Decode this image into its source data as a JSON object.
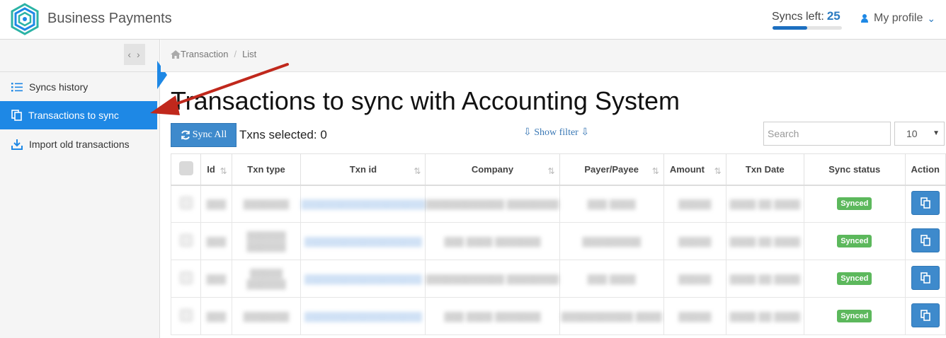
{
  "header": {
    "app_title": "Business Payments",
    "syncs_label": "Syncs left:",
    "syncs_count": "25",
    "syncs_progress": 0.5,
    "profile_label": "My profile",
    "brand_color": "#1e88e5"
  },
  "sidebar": {
    "items": [
      {
        "label": "Syncs history",
        "icon": "list-icon",
        "active": false
      },
      {
        "label": "Transactions to sync",
        "icon": "copy-icon",
        "active": true
      },
      {
        "label": "Import old transactions",
        "icon": "download-icon",
        "active": false
      }
    ]
  },
  "breadcrumb": {
    "items": [
      "Transaction",
      "List"
    ]
  },
  "main": {
    "title": "Transactions to sync with Accounting System",
    "sync_all_label": "Sync All",
    "txns_selected": "Txns selected: 0",
    "show_filter": "Show filter",
    "search_placeholder": "Search",
    "page_size": "10"
  },
  "table": {
    "columns": [
      "Id",
      "Txn type",
      "Txn id",
      "Company",
      "Payer/Payee",
      "Amount",
      "Txn Date",
      "Sync status",
      "Action"
    ],
    "rows": [
      {
        "id": "▒▒▒",
        "type": "▒▒▒▒▒▒▒",
        "txn": "▒▒▒▒▒▒▒▒▒▒▒▒▒▒▒▒▒▒▒",
        "company": "▒▒▒▒▒▒▒▒▒▒▒▒ ▒▒▒▒▒▒▒▒",
        "payer": "▒▒▒ ▒▒▒▒",
        "amount": "▒▒▒▒▒",
        "date": "▒▒▒▒ ▒▒ ▒▒▒▒",
        "status": "Synced"
      },
      {
        "id": "▒▒▒",
        "type": "▒▒▒▒▒▒ ▒▒▒▒▒▒",
        "txn": "▒▒▒▒▒▒▒▒▒▒▒▒▒▒▒▒▒▒",
        "company": "▒▒▒ ▒▒▒▒ ▒▒▒▒▒▒▒",
        "payer": "▒▒▒▒▒▒▒▒▒",
        "amount": "▒▒▒▒▒",
        "date": "▒▒▒▒ ▒▒ ▒▒▒▒",
        "status": "Synced"
      },
      {
        "id": "▒▒▒",
        "type": "▒▒▒▒▒ ▒▒▒▒▒▒",
        "txn": "▒▒▒▒▒▒▒▒▒▒▒▒▒▒▒▒▒▒",
        "company": "▒▒▒▒▒▒▒▒▒▒▒▒ ▒▒▒▒▒▒▒▒",
        "payer": "▒▒▒ ▒▒▒▒",
        "amount": "▒▒▒▒▒",
        "date": "▒▒▒▒ ▒▒ ▒▒▒▒",
        "status": "Synced"
      },
      {
        "id": "▒▒▒",
        "type": "▒▒▒▒▒▒▒",
        "txn": "▒▒▒▒▒▒▒▒▒▒▒▒▒▒▒▒▒▒",
        "company": "▒▒▒ ▒▒▒▒ ▒▒▒▒▒▒▒",
        "payer": "▒▒▒▒▒▒▒▒▒▒▒ ▒▒▒▒",
        "amount": "▒▒▒▒▒",
        "date": "▒▒▒▒ ▒▒ ▒▒▒▒",
        "status": "Synced"
      }
    ]
  }
}
